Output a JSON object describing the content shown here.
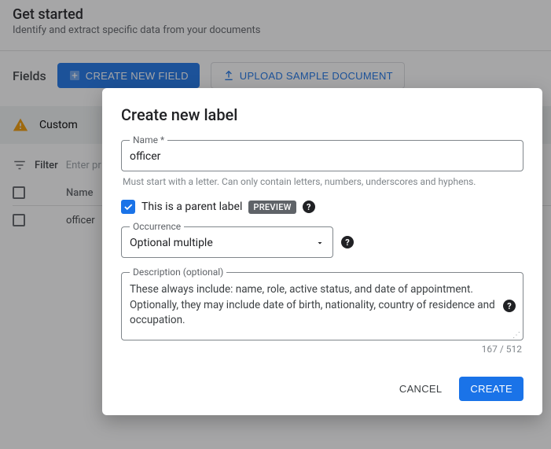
{
  "background": {
    "title": "Get started",
    "subtitle": "Identify and extract specific data from your documents",
    "sectionLabel": "Fields",
    "createFieldBtn": "Create new field",
    "uploadBtn": "Upload sample document",
    "alertText": "Custom",
    "filterLabel": "Filter",
    "filterPlaceholder": "Enter pr",
    "columnName": "Name",
    "row0_name": "officer"
  },
  "modal": {
    "title": "Create new label",
    "nameLabel": "Name *",
    "nameValue": "officer",
    "nameHelper": "Must start with a letter. Can only contain letters, numbers, underscores and hyphens.",
    "parentLabelText": "This is a parent label",
    "previewChip": "PREVIEW",
    "occurrenceLabel": "Occurrence",
    "occurrenceValue": "Optional multiple",
    "descriptionLabel": "Description (optional)",
    "descriptionValue": "These always include: name, role, active status, and date of appointment. Optionally, they may include date of birth, nationality, country of residence and occupation.",
    "counter": "167 / 512",
    "cancelBtn": "Cancel",
    "createBtn": "Create"
  }
}
